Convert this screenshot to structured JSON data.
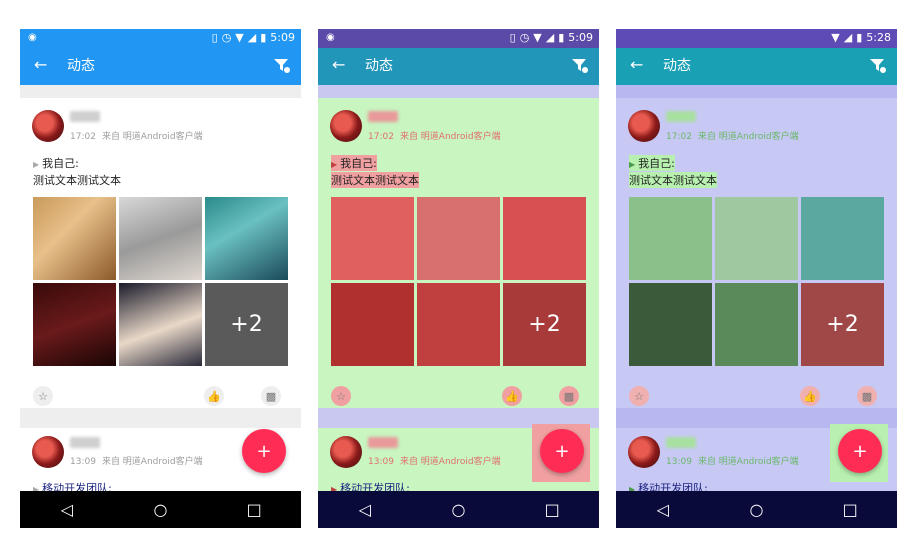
{
  "status": {
    "time1": "5:09",
    "time2": "5:09",
    "time3": "5:28"
  },
  "appbar": {
    "title": "动态"
  },
  "post1": {
    "time": "17:02",
    "source": "来自 明道Android客户端",
    "mention": "我自己:",
    "text": "测试文本测试文本",
    "more_count": "+2"
  },
  "post2": {
    "time": "13:09",
    "source": "来自 明道Android客户端",
    "mention": "移动开发团队:"
  },
  "fab": {
    "label": "+"
  },
  "icons": {
    "back": "arrow-left-icon",
    "filter": "filter-icon",
    "star": "star-icon",
    "like": "thumb-up-icon",
    "comment": "comment-icon",
    "nav_back": "triangle-back-icon",
    "nav_home": "circle-home-icon",
    "nav_recent": "square-recent-icon"
  },
  "colors": {
    "primary1": "#2196f3",
    "primary2": "#2196b8",
    "primary3": "#1aa0b5",
    "status2": "#5b4aa8",
    "status3": "#5f4bb5",
    "navbar": "#000000",
    "navbar_tinted": "#0a0a3a",
    "fab": "#ff2d55",
    "overdraw_green": "#b8f5b0",
    "overdraw_purple": "#b8b8f5",
    "overdraw_red": "#f07070"
  }
}
